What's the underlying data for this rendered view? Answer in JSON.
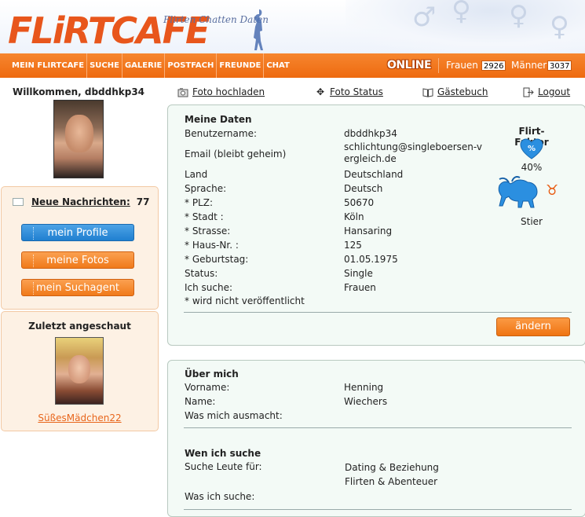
{
  "header": {
    "logo_part1": "FLiRT",
    "logo_part2": "CAFE",
    "slogan": "Flirten Chatten Daten"
  },
  "nav": {
    "items": [
      "MEIN FLIRTCAFE",
      "SUCHE",
      "GALERIE",
      "POSTFACH",
      "FREUNDE",
      "CHAT"
    ],
    "online_label": "ONLINE",
    "women_label": "Frauen",
    "women_count": "2926",
    "men_label": "Männer",
    "men_count": "3037"
  },
  "sidebar": {
    "welcome": "Willkommen, dbddhkp34",
    "messages_label": "Neue Nachrichten:",
    "messages_count": "77",
    "buttons": [
      "mein Profile",
      "meine Fotos",
      "mein Suchagent"
    ],
    "last_seen_title": "Zuletzt angeschaut",
    "last_seen_user": "SüßesMädchen22"
  },
  "actions": {
    "upload": "Foto hochladen",
    "status": "Foto Status",
    "guestbook": "Gästebuch",
    "logout": "Logout"
  },
  "my_data": {
    "title": "Meine Daten",
    "fields": [
      {
        "label": "Benutzername:",
        "value": "dbddhkp34"
      },
      {
        "label": "Email (bleibt geheim)",
        "value": "schlichtung@singleboersen-vergleich.de"
      },
      {
        "label": "Land",
        "value": "Deutschland"
      },
      {
        "label": "Sprache:",
        "value": "Deutsch"
      },
      {
        "label": "* PLZ:",
        "value": "50670"
      },
      {
        "label": "* Stadt :",
        "value": "Köln"
      },
      {
        "label": "* Strasse:",
        "value": "Hansaring"
      },
      {
        "label": "* Haus-Nr. :",
        "value": "125"
      },
      {
        "label": "* Geburtstag:",
        "value": "01.05.1975"
      },
      {
        "label": "Status:",
        "value": "Single"
      },
      {
        "label": "Ich suche:",
        "value": "Frauen"
      }
    ],
    "footnote": "* wird nicht veröffentlicht",
    "edit_button": "ändern",
    "flirt_faktor_title": "Flirt-Faktor",
    "flirt_faktor_value": "40%",
    "flirt_faktor_level": 0.4,
    "zodiac": "Stier"
  },
  "about": {
    "title": "Über mich",
    "fields": [
      {
        "label": "Vorname:",
        "value": "Henning"
      },
      {
        "label": "Name:",
        "value": "Wiechers"
      },
      {
        "label": "Was mich ausmacht:",
        "value": ""
      }
    ]
  },
  "search": {
    "title": "Wen ich suche",
    "looking_for_label": "Suche Leute für:",
    "looking_for_values": [
      "Dating & Beziehung",
      "Flirten & Abenteuer"
    ],
    "what_label": "Was ich suche:"
  },
  "colors": {
    "accent_orange": "#ee6a10",
    "button_blue": "#1f7fd0",
    "link_orange": "#e8661c"
  }
}
